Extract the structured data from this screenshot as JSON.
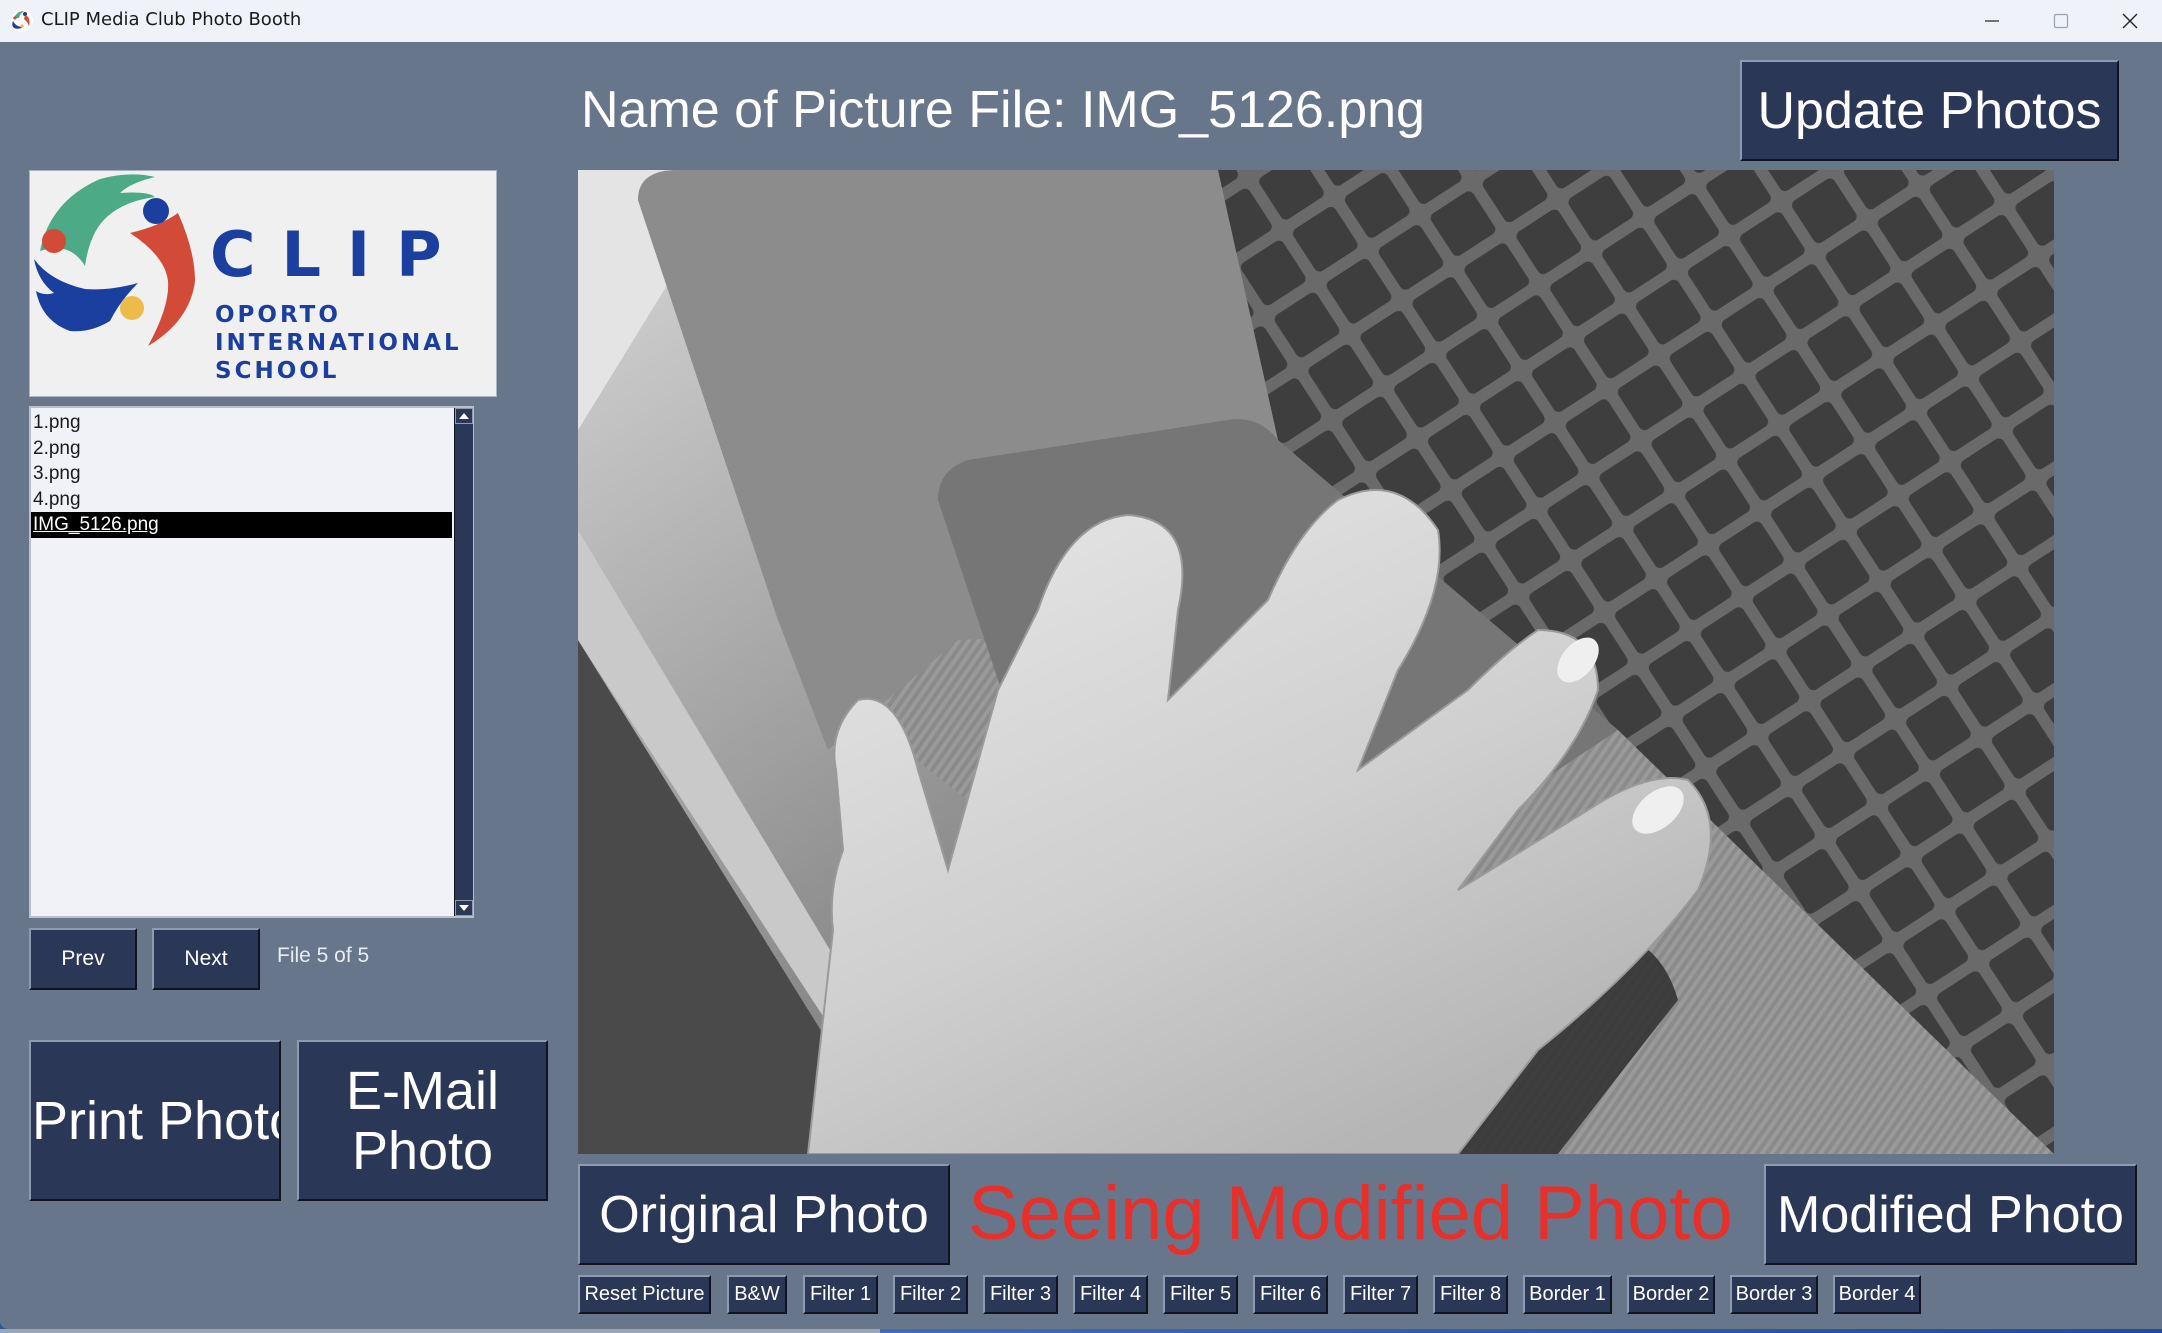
{
  "window": {
    "title": "CLIP Media Club Photo Booth",
    "controls": [
      "minimize",
      "maximize",
      "close"
    ]
  },
  "logo": {
    "wordmark": "CLIP",
    "line1": "OPORTO",
    "line2": "INTERNATIONAL",
    "line3": "SCHOOL",
    "colors": {
      "green": "#4daa87",
      "red": "#d14b38",
      "blue": "#1a3f9e",
      "yellow": "#ecbb4a"
    }
  },
  "file_list": {
    "items": [
      {
        "label": "1.png",
        "selected": false
      },
      {
        "label": "2.png",
        "selected": false
      },
      {
        "label": "3.png",
        "selected": false
      },
      {
        "label": "4.png",
        "selected": false
      },
      {
        "label": "IMG_5126.png",
        "selected": true
      }
    ]
  },
  "navigation": {
    "prev_label": "Prev",
    "next_label": "Next",
    "file_counter": "File 5 of 5"
  },
  "actions": {
    "print_label": "Print Photo",
    "email_line1": "E-Mail",
    "email_line2": "Photo",
    "update_label": "Update Photos"
  },
  "header": {
    "file_name_label": "Name of Picture File: IMG_5126.png"
  },
  "photo": {
    "description": "Grayscale photo of a hand on a laptop keyboard and trackpad",
    "mode": "grayscale"
  },
  "view_toggle": {
    "original_label": "Original Photo",
    "status_text": "Seeing Modified Photo",
    "status_color": "#e8302a",
    "modified_label": "Modified Photo"
  },
  "tools": [
    "Reset Picture",
    "B&W",
    "Filter 1",
    "Filter 2",
    "Filter 3",
    "Filter 4",
    "Filter 5",
    "Filter 6",
    "Filter 7",
    "Filter 8",
    "Border 1",
    "Border 2",
    "Border 3",
    "Border 4"
  ],
  "theme": {
    "background": "#68768c",
    "button": "#2b3756",
    "titlebar": "#eff2f8"
  }
}
